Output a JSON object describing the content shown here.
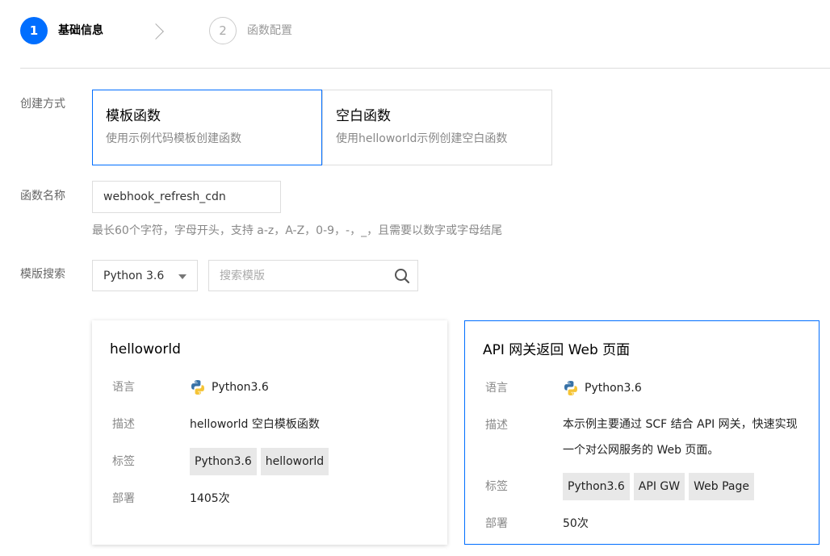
{
  "steps": [
    {
      "num": "1",
      "label": "基础信息"
    },
    {
      "num": "2",
      "label": "函数配置"
    }
  ],
  "form": {
    "method_label": "创建方式",
    "methods": [
      {
        "title": "模板函数",
        "desc": "使用示例代码模板创建函数"
      },
      {
        "title": "空白函数",
        "desc": "使用helloworld示例创建空白函数"
      }
    ],
    "name_label": "函数名称",
    "name_value": "webhook_refresh_cdn",
    "name_hint": "最长60个字符，字母开头，支持 a-z，A-Z，0-9，-，_，且需要以数字或字母结尾",
    "search_label": "模版搜索",
    "runtime_selected": "Python 3.6",
    "search_placeholder": "搜索模版"
  },
  "templates": [
    {
      "title": "helloworld",
      "lang_key": "语言",
      "lang": "Python3.6",
      "desc_key": "描述",
      "desc": "helloworld 空白模板函数",
      "tags_key": "标签",
      "tags": [
        "Python3.6",
        "helloworld"
      ],
      "deploy_key": "部署",
      "deploy": "1405次"
    },
    {
      "title": "API 网关返回 Web 页面",
      "lang_key": "语言",
      "lang": "Python3.6",
      "desc_key": "描述",
      "desc_line1": "本示例主要通过 SCF 结合 API 网关，快速实现",
      "desc_line2": "一个对公网服务的 Web 页面。",
      "tags_key": "标签",
      "tags": [
        "Python3.6",
        "API GW",
        "Web Page"
      ],
      "deploy_key": "部署",
      "deploy": "50次"
    }
  ],
  "colors": {
    "accent": "#006eff"
  },
  "icons": {
    "python": "python-logo-icon",
    "search": "search-icon",
    "chevron": "chevron-right-icon"
  }
}
